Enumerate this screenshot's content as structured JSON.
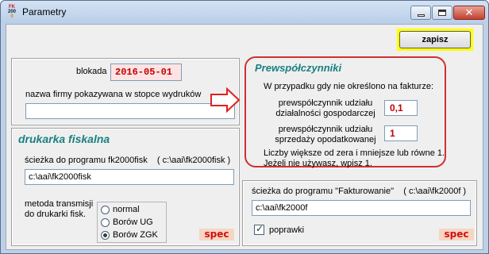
{
  "window": {
    "title": "Parametry",
    "icon_lines": [
      "FK",
      "200",
      "0"
    ],
    "close_glyph": "✕"
  },
  "toolbar": {
    "save_label": "zapisz"
  },
  "general": {
    "blokada_label": "blokada",
    "blokada_value": "2016-05-01",
    "firm_name_label": "nazwa firmy pokazywana w stopce wydruków",
    "firm_name_value": ""
  },
  "fiscal_printer": {
    "section_title": "drukarka fiskalna",
    "path_label": "ścieżka do programu fk2000fisk    ( c:\\aai\\fk2000fisk )",
    "path_value": "c:\\aai\\fk2000fisk",
    "transmission_label_line1": "metoda transmisji",
    "transmission_label_line2": "do drukarki fisk.",
    "options": [
      "normal",
      "Borów UG",
      "Borów ZGK"
    ],
    "selected_option": "Borów ZGK",
    "spec_label": "spec"
  },
  "coefficients": {
    "title": "Prewspółczynniki",
    "intro": "W przypadku gdy nie określono na fakturze:",
    "activity_label_line1": "prewspółczynnik udziału",
    "activity_label_line2": "działalności gospodarczej",
    "activity_value": "0,1",
    "sales_label_line1": "prewspółczynnik udziału",
    "sales_label_line2": "sprzedaży opodatkowanej",
    "sales_value": "1",
    "note_line1": "Liczby większe od zera i mniejsze lub równe 1.",
    "note_line2": "Jeżeli nie używasz, wpisz 1."
  },
  "invoicing": {
    "path_label": "ścieżka do programu \"Fakturowanie\"    ( c:\\aai\\fk2000f )",
    "path_value": "c:\\aai\\fk2000f",
    "fixes_label": "poprawki",
    "fixes_checked": true,
    "spec_label": "spec"
  },
  "colors": {
    "window_frame": "#bdd0e6",
    "save_highlight": "#ffff00",
    "section_title": "#1a8080",
    "accent_red": "#d03030",
    "value_red": "#c00000",
    "spec_bg": "#f7d5c3"
  }
}
